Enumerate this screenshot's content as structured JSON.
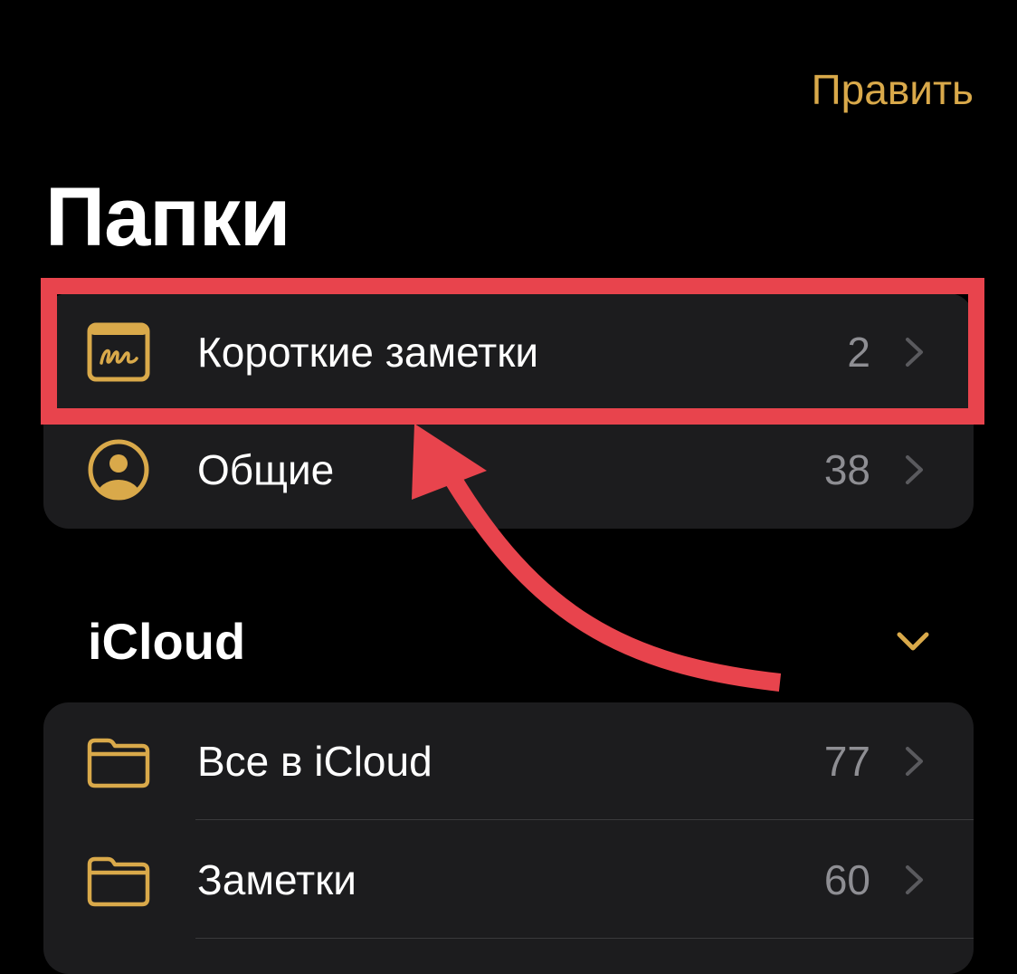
{
  "header": {
    "edit_label": "Править"
  },
  "title": "Папки",
  "top_group": {
    "items": [
      {
        "label": "Короткие заметки",
        "count": "2",
        "icon": "quick-note-icon"
      },
      {
        "label": "Общие",
        "count": "38",
        "icon": "person-circle-icon"
      }
    ]
  },
  "icloud": {
    "title": "iCloud",
    "collapse_icon": "chevron-down-icon",
    "items": [
      {
        "label": "Все в iCloud",
        "count": "77",
        "icon": "folder-icon"
      },
      {
        "label": "Заметки",
        "count": "60",
        "icon": "folder-icon"
      }
    ]
  },
  "colors": {
    "accent": "#D9A94A",
    "highlight": "#E8444D",
    "row_background": "#1c1c1e",
    "count_text": "#8e8e93"
  }
}
